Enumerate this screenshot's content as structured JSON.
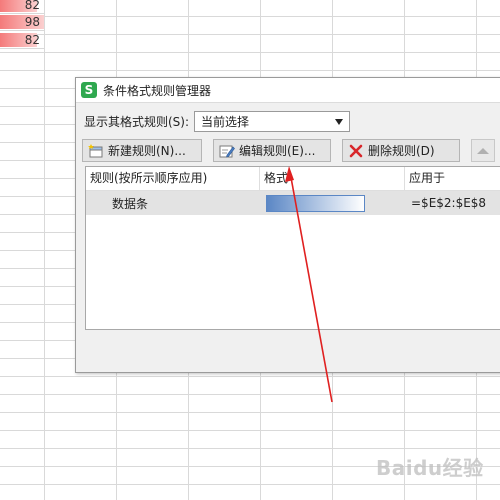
{
  "spreadsheet": {
    "cells": [
      {
        "value": "82",
        "bar_fraction": 0.83
      },
      {
        "value": "98",
        "bar_fraction": 1.0
      },
      {
        "value": "82",
        "bar_fraction": 0.83
      }
    ]
  },
  "dialog": {
    "title": "条件格式规则管理器",
    "app_icon_glyph": "S",
    "show_rules_label": "显示其格式规则(S):",
    "show_rules_value": "当前选择",
    "buttons": {
      "new_rule": "新建规则(N)...",
      "edit_rule": "编辑规则(E)...",
      "delete_rule": "删除规则(D)"
    },
    "columns": {
      "rule": "规则(按所示顺序应用)",
      "format": "格式",
      "applies_to": "应用于"
    },
    "rules": [
      {
        "rule": "数据条",
        "applies_to": "=$E$2:$E$8"
      }
    ]
  },
  "watermark": "Baidu经验",
  "colors": {
    "excel_bar": "#f47a7a",
    "data_bar_preview": "#5b87c5",
    "arrow": "#e02020",
    "app_icon": "#2fa84f"
  }
}
